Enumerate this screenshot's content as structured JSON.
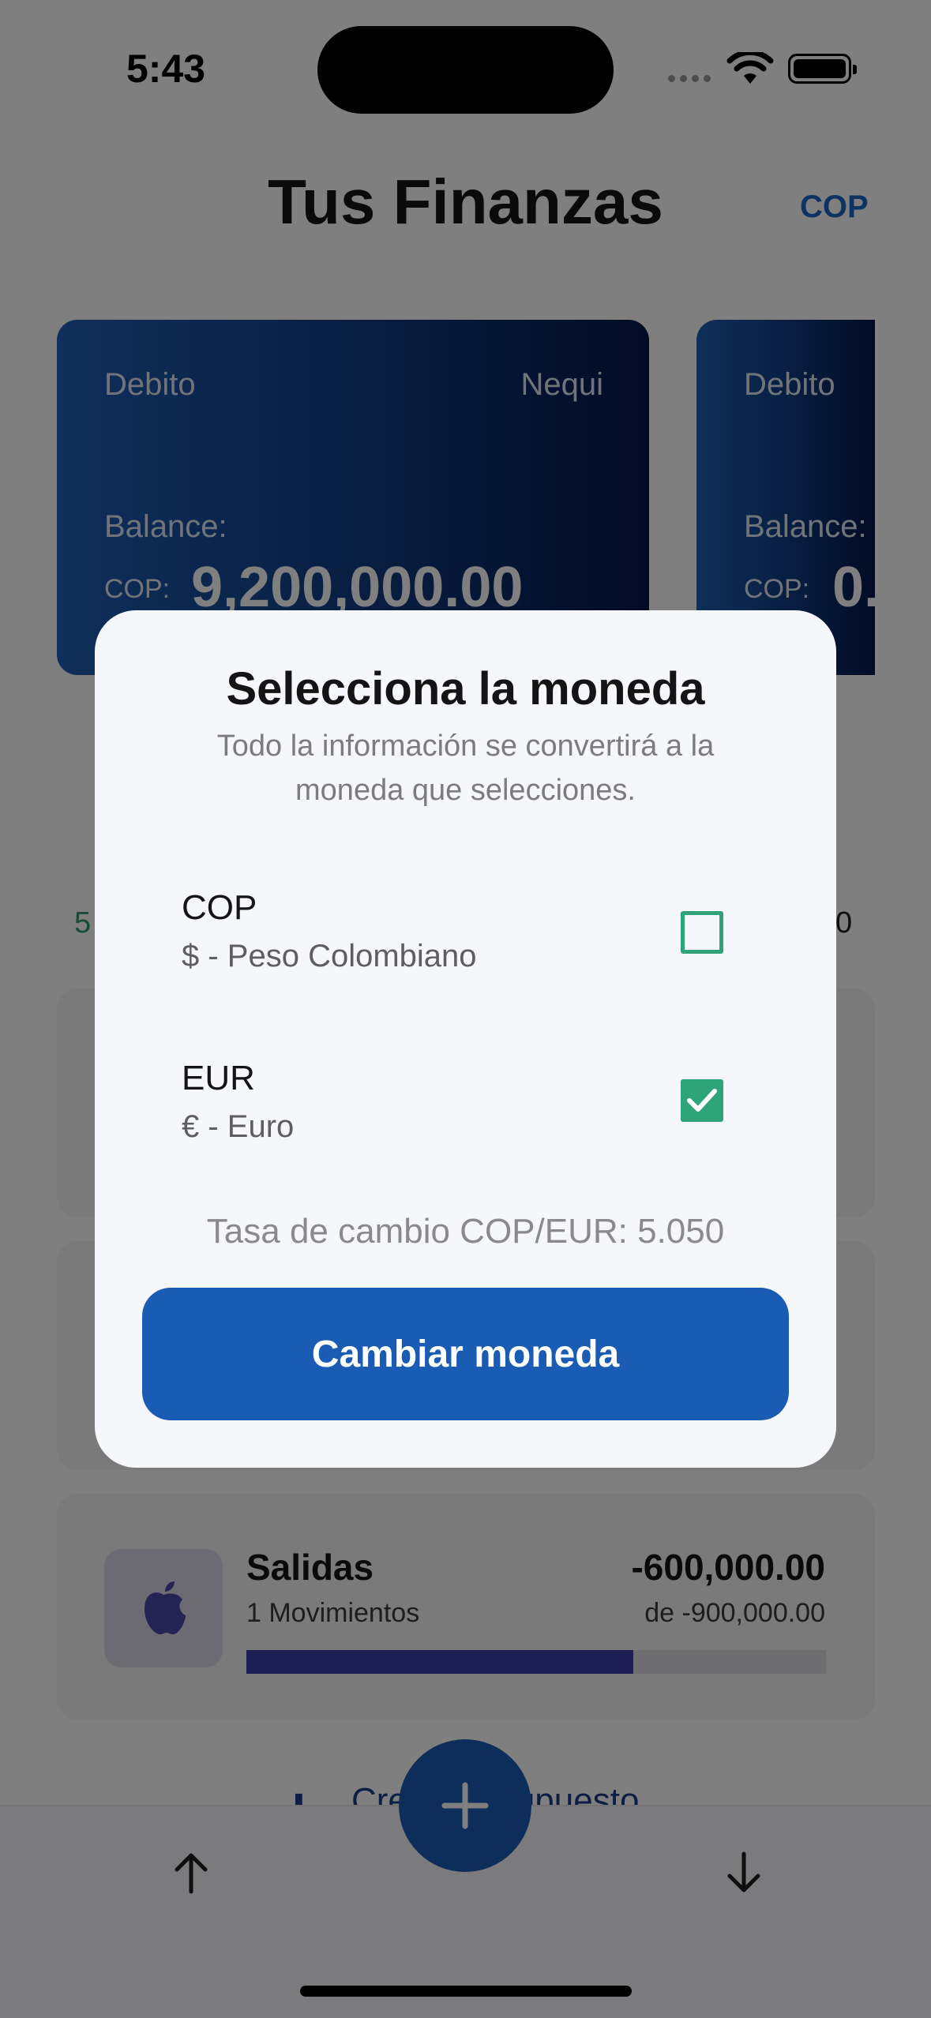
{
  "status_bar": {
    "time": "5:43"
  },
  "header": {
    "title": "Tus Finanzas",
    "currency": "COP"
  },
  "cards": [
    {
      "type": "Debito",
      "bank": "Nequi",
      "balance_label": "Balance:",
      "currency": "COP:",
      "amount": "9,200,000.00"
    },
    {
      "type": "Debito",
      "balance_label": "Balance:",
      "currency": "COP:",
      "amount": "0."
    }
  ],
  "background": {
    "left_fragment": "5",
    "right_fragment": "0"
  },
  "budget": {
    "title": "Salidas",
    "movements": "1 Movimientos",
    "spent": "-600,000.00",
    "limit": "de -900,000.00",
    "progress": 0.667,
    "icon": "apple-icon"
  },
  "create_budget": {
    "label": "Crear presupuesto"
  },
  "modal": {
    "title": "Selecciona la moneda",
    "description": "Todo la información se convertirá a la moneda que selecciones.",
    "options": [
      {
        "code": "COP",
        "name": "$ - Peso Colombiano",
        "selected": false
      },
      {
        "code": "EUR",
        "name": "€ - Euro",
        "selected": true
      }
    ],
    "rate": "Tasa de cambio COP/EUR: 5.050",
    "button": "Cambiar moneda"
  },
  "colors": {
    "accent": "#1a5cb4",
    "check": "#2fa37a",
    "card_dark": "#04164a"
  }
}
